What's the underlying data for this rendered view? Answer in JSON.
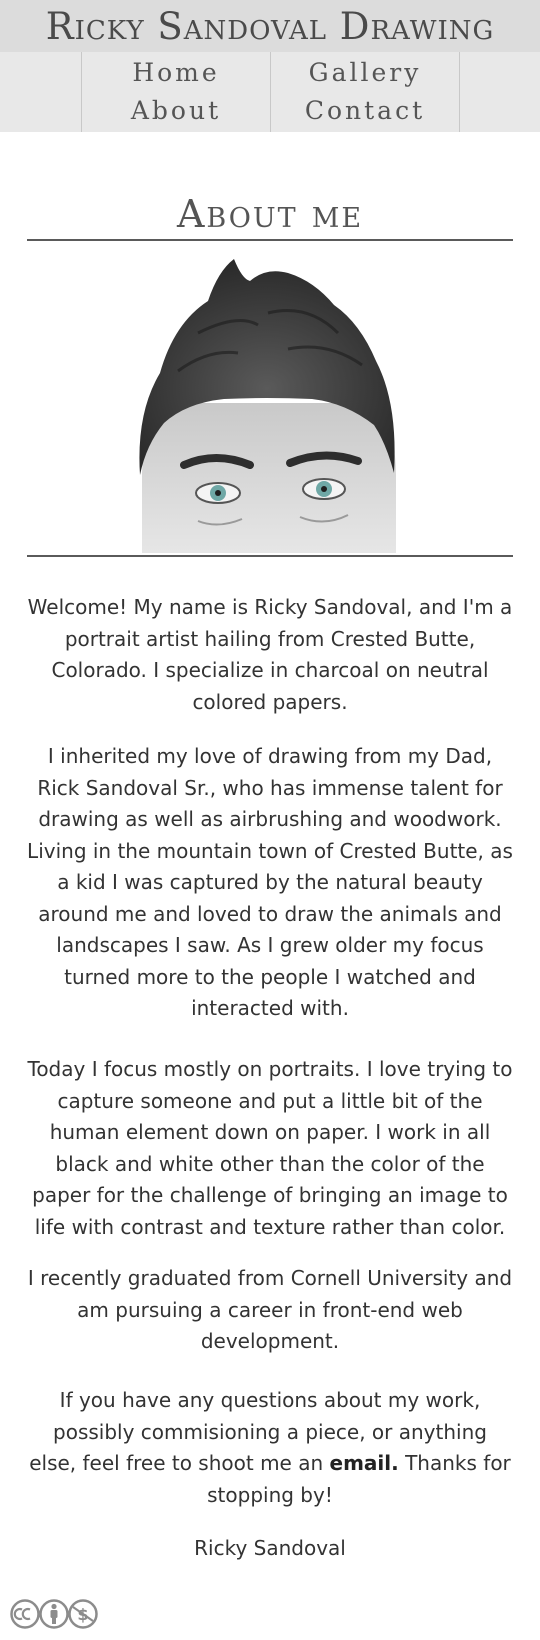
{
  "header": {
    "site_title": "Ricky Sandoval Drawing",
    "nav": [
      {
        "label": "Home"
      },
      {
        "label": "Gallery"
      },
      {
        "label": "About"
      },
      {
        "label": "Contact"
      }
    ]
  },
  "main": {
    "heading": "About me",
    "portrait_icon": "portrait-photo",
    "paragraphs": [
      "Welcome! My name is Ricky Sandoval, and I'm a portrait artist hailing from Crested Butte, Colorado. I specialize in charcoal on neutral colored papers.",
      "I inherited my love of drawing from my Dad, Rick Sandoval Sr., who has immense talent for drawing as well as airbrushing and woodwork. Living in the mountain town of Crested Butte, as a kid I was captured by the natural beauty around me and loved to draw the animals and landscapes I saw. As I grew older my focus turned more to the people I watched and interacted with.",
      "Today I focus mostly on portraits. I love trying to capture someone and put a little bit of the human element down on paper. I work in all black and white other than the color of the paper for the challenge of bringing an image to life with contrast and texture rather than color.",
      "I recently graduated from Cornell University and am pursuing a career in front-end web development."
    ],
    "contact_paragraph": {
      "before": "If you have any questions about my work, possibly commisioning a piece, or anything else, feel free to shoot me an ",
      "link": "email.",
      "after": " Thanks for stopping by!"
    },
    "signature": "Ricky Sandoval"
  },
  "footer": {
    "license_icon": "creative-commons-by-nc-badge"
  }
}
